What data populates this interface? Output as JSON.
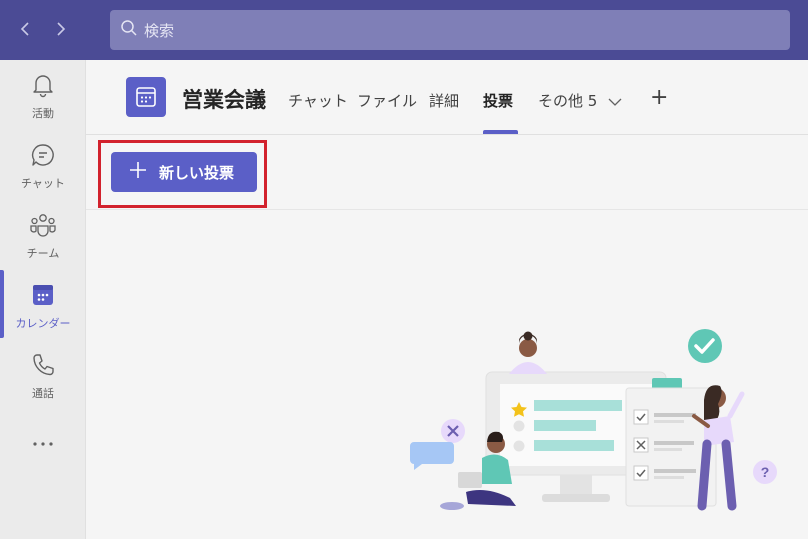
{
  "topbar": {
    "back_icon": "chevron-left-icon",
    "forward_icon": "chevron-right-icon",
    "search": {
      "icon": "search-icon",
      "placeholder": "検索"
    }
  },
  "rail": {
    "items": [
      {
        "label": "活動",
        "icon": "bell-icon"
      },
      {
        "label": "チャット",
        "icon": "chat-icon"
      },
      {
        "label": "チーム",
        "icon": "teams-icon"
      },
      {
        "label": "カレンダー",
        "icon": "calendar-icon",
        "active": true
      },
      {
        "label": "通話",
        "icon": "phone-icon"
      }
    ],
    "more": "..."
  },
  "channel": {
    "title": "営業会議",
    "tabs": [
      {
        "label": "チャット"
      },
      {
        "label": "ファイル"
      },
      {
        "label": "詳細"
      },
      {
        "label": "投票",
        "active": true
      },
      {
        "label": "その他 5"
      }
    ],
    "add_tab": "+"
  },
  "toolbar": {
    "new_poll_label": "新しい投票"
  },
  "colors": {
    "accent": "#5b5fc7",
    "topbar": "#4b4b95",
    "highlight": "#d2222d"
  }
}
